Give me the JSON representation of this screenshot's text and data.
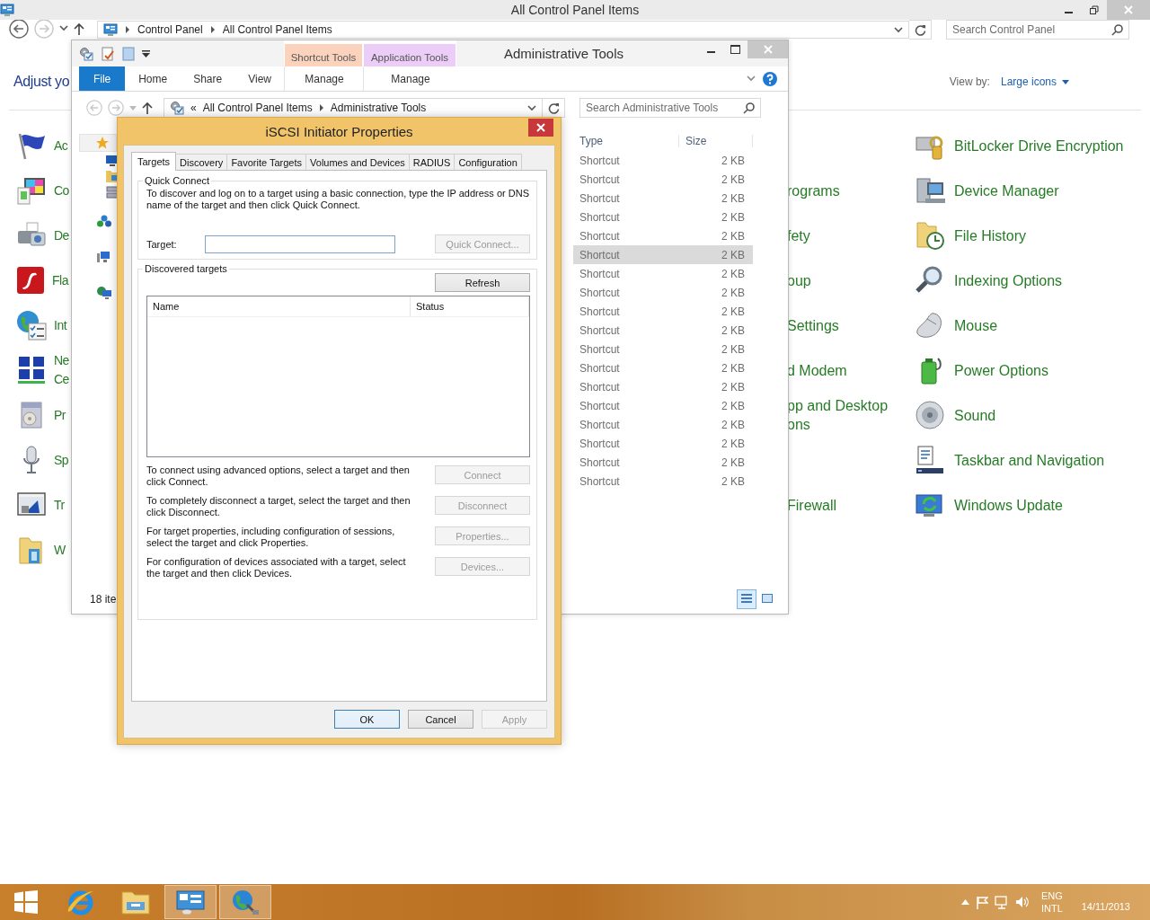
{
  "control_panel": {
    "title": "All Control Panel Items",
    "breadcrumb": [
      "Control Panel",
      "All Control Panel Items"
    ],
    "search": {
      "placeholder": "Search Control Panel"
    },
    "heading": "Adjust yo",
    "view_by_label": "View by:",
    "view_by_value": "Large icons",
    "rows": [
      {
        "left": "Ac",
        "right": "BitLocker Drive Encryption"
      },
      {
        "left": "Co",
        "middle": "rograms",
        "right": "Device Manager"
      },
      {
        "left": "De",
        "middle": "fety",
        "right": "File History"
      },
      {
        "left": "Fla",
        "middle": "oup",
        "right": "Indexing Options"
      },
      {
        "left": "Int",
        "middle": "Settings",
        "right": "Mouse"
      },
      {
        "left": "Ne\nCe",
        "middle": "d Modem",
        "right": "Power Options"
      },
      {
        "left": "Pr",
        "middle": "pp and Desktop\nons",
        "right": "Sound"
      },
      {
        "left": "Sp",
        "right": "Taskbar and Navigation"
      },
      {
        "left": "Tr",
        "middle": "Firewall",
        "right": "Windows Update"
      },
      {
        "left": "W"
      }
    ]
  },
  "explorer": {
    "title": "Administrative Tools",
    "context_tabs": [
      {
        "label": "Shortcut Tools",
        "color": "#fbd3bd",
        "tab": "Manage"
      },
      {
        "label": "Application Tools",
        "color": "#ebcdf7",
        "tab": "Manage"
      }
    ],
    "file_button": "File",
    "tabs": [
      "Home",
      "Share",
      "View"
    ],
    "address_overflow": "«",
    "address": [
      "All Control Panel Items",
      "Administrative Tools"
    ],
    "search": {
      "placeholder": "Search Administrative Tools"
    },
    "columns": [
      "Type",
      "Size"
    ],
    "rows": [
      {
        "type": "Shortcut",
        "size": "2 KB",
        "selected": false
      },
      {
        "type": "Shortcut",
        "size": "2 KB",
        "selected": false
      },
      {
        "type": "Shortcut",
        "size": "2 KB",
        "selected": false
      },
      {
        "type": "Shortcut",
        "size": "2 KB",
        "selected": false
      },
      {
        "type": "Shortcut",
        "size": "2 KB",
        "selected": false
      },
      {
        "type": "Shortcut",
        "size": "2 KB",
        "selected": true
      },
      {
        "type": "Shortcut",
        "size": "2 KB",
        "selected": false
      },
      {
        "type": "Shortcut",
        "size": "2 KB",
        "selected": false
      },
      {
        "type": "Shortcut",
        "size": "2 KB",
        "selected": false
      },
      {
        "type": "Shortcut",
        "size": "2 KB",
        "selected": false
      },
      {
        "type": "Shortcut",
        "size": "2 KB",
        "selected": false
      },
      {
        "type": "Shortcut",
        "size": "2 KB",
        "selected": false
      },
      {
        "type": "Shortcut",
        "size": "2 KB",
        "selected": false
      },
      {
        "type": "Shortcut",
        "size": "2 KB",
        "selected": false
      },
      {
        "type": "Shortcut",
        "size": "2 KB",
        "selected": false
      },
      {
        "type": "Shortcut",
        "size": "2 KB",
        "selected": false
      },
      {
        "type": "Shortcut",
        "size": "2 KB",
        "selected": false
      },
      {
        "type": "Shortcut",
        "size": "2 KB",
        "selected": false
      }
    ],
    "status": "18 ite",
    "view_buttons": [
      {
        "selected": true
      },
      {
        "selected": false
      }
    ]
  },
  "dialog": {
    "title": "iSCSI Initiator Properties",
    "tabs": [
      {
        "label": "Targets",
        "selected": true
      },
      {
        "label": "Discovery",
        "selected": false
      },
      {
        "label": "Favorite Targets",
        "selected": false
      },
      {
        "label": "Volumes and Devices",
        "selected": false
      },
      {
        "label": "RADIUS",
        "selected": false
      },
      {
        "label": "Configuration",
        "selected": false
      }
    ],
    "quick_connect": {
      "legend": "Quick Connect",
      "text": "To discover and log on to a target using a basic connection, type the IP address or DNS name of the target and then click Quick Connect.",
      "target_label": "Target:",
      "button": {
        "label": "Quick Connect...",
        "disabled": true
      }
    },
    "discovered": {
      "legend": "Discovered targets",
      "refresh": {
        "label": "Refresh",
        "disabled": false
      },
      "columns": [
        "Name",
        "Status"
      ]
    },
    "actions": [
      {
        "text": "To connect using advanced options, select a target and then click Connect.",
        "button": {
          "label": "Connect",
          "disabled": true
        }
      },
      {
        "text": "To completely disconnect a target, select the target and then click Disconnect.",
        "button": {
          "label": "Disconnect",
          "disabled": true
        }
      },
      {
        "text": "For target properties, including configuration of sessions, select the target and click Properties.",
        "button": {
          "label": "Properties...",
          "disabled": true
        }
      },
      {
        "text": "For configuration of devices associated with a target, select the target and then click Devices.",
        "button": {
          "label": "Devices...",
          "disabled": true
        }
      }
    ],
    "footer": [
      {
        "label": "OK",
        "disabled": false,
        "default": true
      },
      {
        "label": "Cancel",
        "disabled": false,
        "default": false
      },
      {
        "label": "Apply",
        "disabled": true,
        "default": false
      }
    ]
  },
  "taskbar": {
    "items": [
      {
        "kind": "start",
        "running": false
      },
      {
        "kind": "browser",
        "running": false
      },
      {
        "kind": "files",
        "running": false
      },
      {
        "kind": "control-panel",
        "running": true
      },
      {
        "kind": "iscsi",
        "running": true
      }
    ],
    "tray": {
      "language": "ENG",
      "layout": "INTL",
      "date": "14/11/2013"
    }
  }
}
